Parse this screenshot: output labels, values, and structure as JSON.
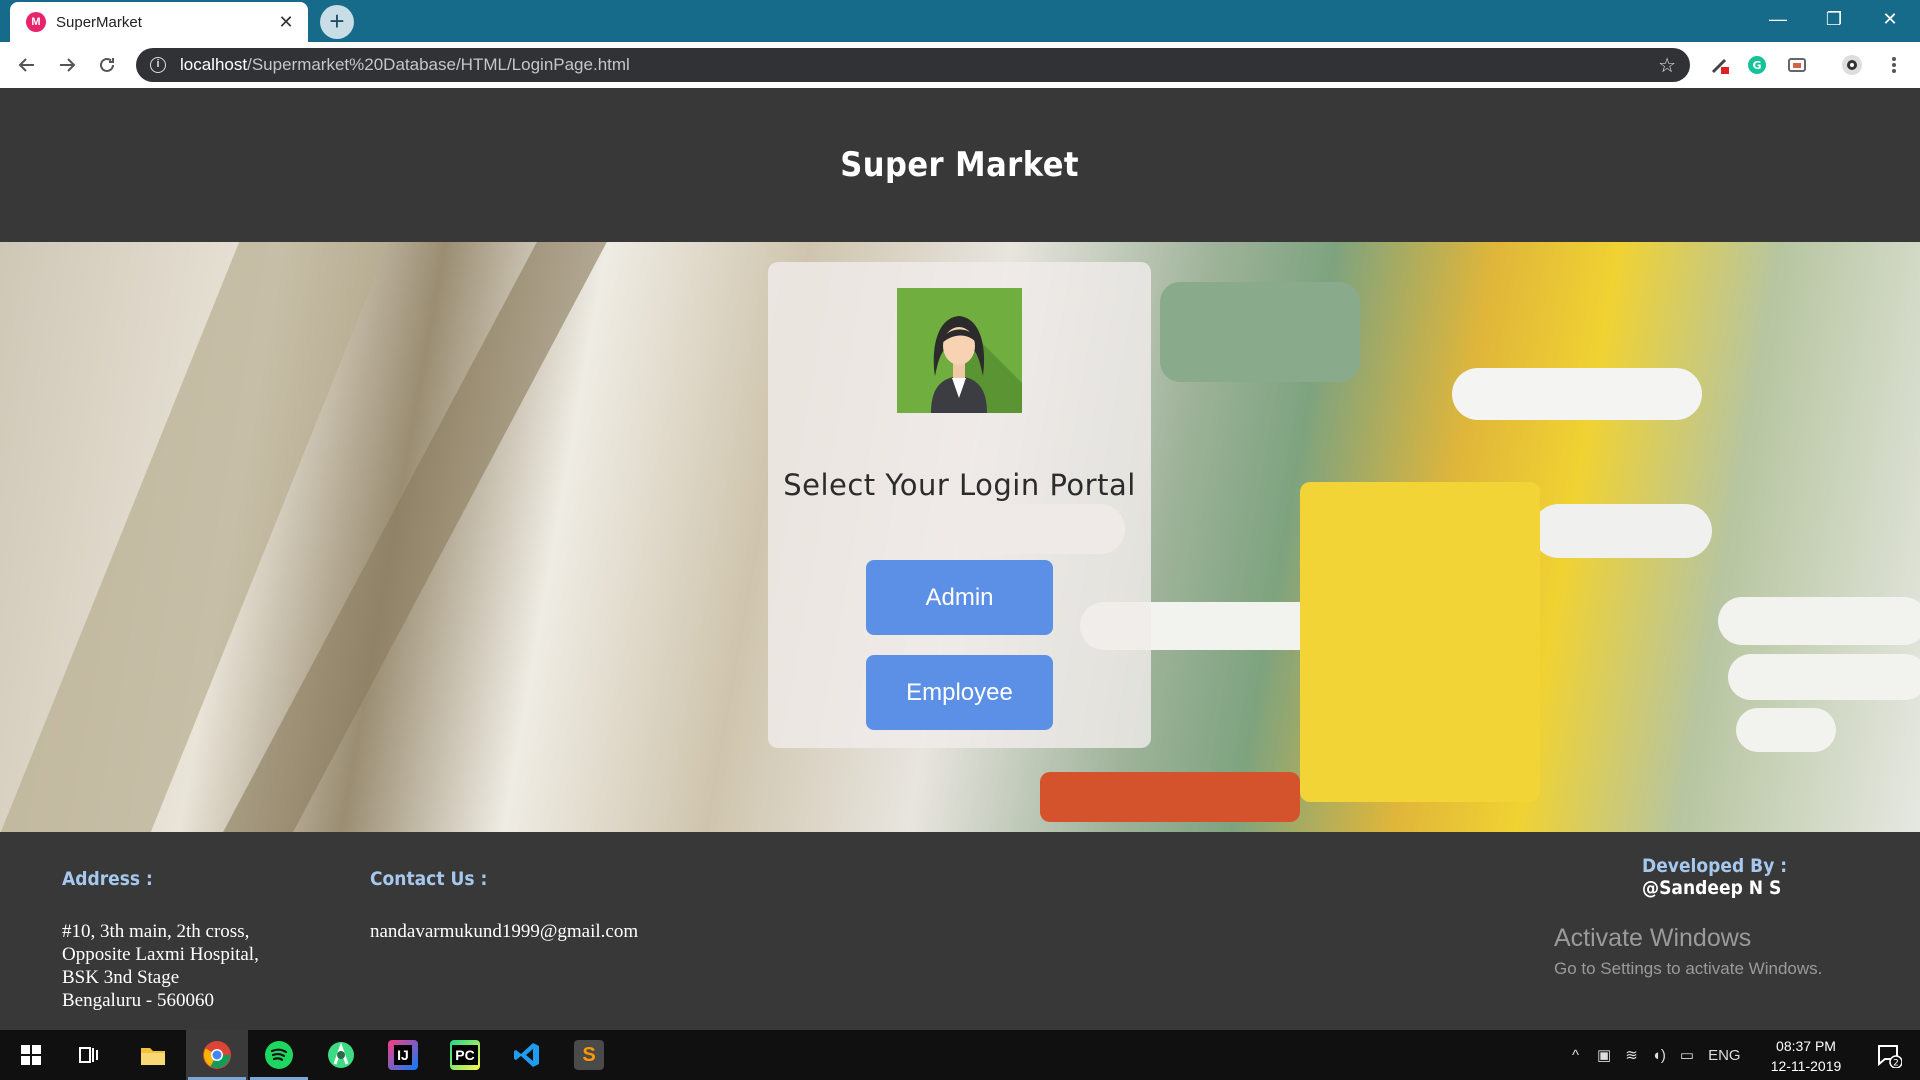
{
  "browser": {
    "tab_title": "SuperMarket",
    "tab_close": "✕",
    "new_tab": "+",
    "url_host": "localhost",
    "url_path": "/Supermarket%20Database/HTML/LoginPage.html",
    "window_controls": {
      "minimize": "—",
      "restore": "❐",
      "close": "✕"
    }
  },
  "page": {
    "site_title": "Super Market",
    "portal_title": "Select Your Login Portal",
    "buttons": {
      "admin": "Admin",
      "employee": "Employee"
    }
  },
  "footer": {
    "address_label": "Address :",
    "address_lines": [
      "#10, 3th main, 2th cross,",
      "Opposite Laxmi Hospital,",
      "BSK 3nd Stage",
      "Bengaluru - 560060"
    ],
    "contact_label": "Contact Us :",
    "email": "nandavarmukund1999@gmail.com",
    "developed_label": "Developed By :",
    "developer": "@Sandeep N S"
  },
  "watermark": {
    "line1": "Activate Windows",
    "line2": "Go to Settings to activate Windows."
  },
  "taskbar": {
    "lang": "ENG",
    "time": "08:37 PM",
    "date": "12-11-2019",
    "notifications": "2"
  },
  "colors": {
    "tabstrip": "#166b8a",
    "header_bg": "#383838",
    "button_blue": "#5c8fe6",
    "footer_label": "#a6c8ee",
    "avatar_green": "#6fae3f"
  }
}
